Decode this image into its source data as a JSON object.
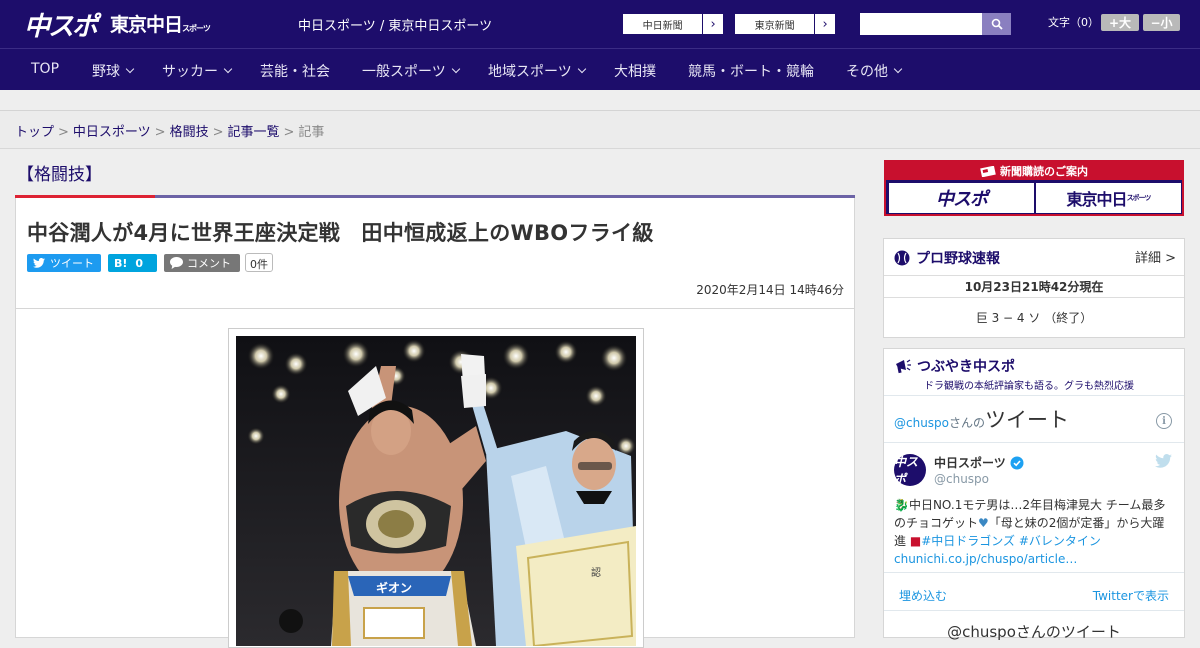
{
  "header": {
    "logo_chuspo": "中スポ",
    "logo_tokyo": "東京中日",
    "logo_tokyo_small": "スポーツ",
    "site_title": "中日スポーツ / 東京中日スポーツ",
    "btn_chunichi": "中日新聞",
    "btn_tokyo": "東京新聞",
    "search_placeholder": "",
    "font_size_label": "文字（0）",
    "font_larger": "+大",
    "font_smaller": "−小",
    "brand_color": "#1d0d6b"
  },
  "nav": {
    "items": [
      {
        "label": "TOP"
      },
      {
        "label": "野球"
      },
      {
        "label": "サッカー"
      },
      {
        "label": "芸能・社会"
      },
      {
        "label": "一般スポーツ"
      },
      {
        "label": "地域スポーツ"
      },
      {
        "label": "大相撲"
      },
      {
        "label": "競馬・ボート・競輪"
      },
      {
        "label": "その他"
      }
    ]
  },
  "breadcrumb": {
    "items": [
      "トップ",
      "中日スポーツ",
      "格闘技",
      "記事一覧",
      "記事"
    ],
    "separator": ">"
  },
  "article": {
    "category": "【格闘技】",
    "headline": "中谷潤人が4月に世界王座決定戦　田中恒成返上のWBOフライ級",
    "tweet_label": "ツイート",
    "hatena_label": "B!",
    "hatena_count": "0",
    "comment_label": "コメント",
    "comment_count": "0件",
    "date": "2020年2月14日 14時46分"
  },
  "sidebar": {
    "banner_title": "新聞購読のご案内",
    "banner_chuspo": "中スポ",
    "banner_tokyo": "東京中日",
    "banner_tokyo_small": "スポーツ",
    "baseball": {
      "title": "プロ野球速報",
      "more": "詳細 >",
      "time": "10月23日21時42分現在",
      "score": "巨 3 − 4 ソ  （終了）"
    },
    "tsubuyaki": {
      "title": "つぶやき中スポ",
      "subtitle": "ドラ観戦の本紙評論家も語る。グラも熱烈応援",
      "timeline_handle": "@chuspo",
      "timeline_suffix": "さんの",
      "timeline_title": "ツイート",
      "author_name": "中日スポーツ",
      "author_handle": "@chuspo",
      "avatar_text": "中スポ",
      "tweet_text_1": "中日NO.1モテ男は…2年目梅津晃大 チーム最多のチョコゲット",
      "tweet_text_2": "「母と妹の2個が定番」から大躍進",
      "tweet_hashtags": "#中日ドラゴンズ #バレンタイン",
      "tweet_link": "chunichi.co.jp/chuspo/article…",
      "embed_label": "埋め込む",
      "view_label": "Twitterで表示",
      "more_label": "@chuspoさんのツイート"
    }
  }
}
